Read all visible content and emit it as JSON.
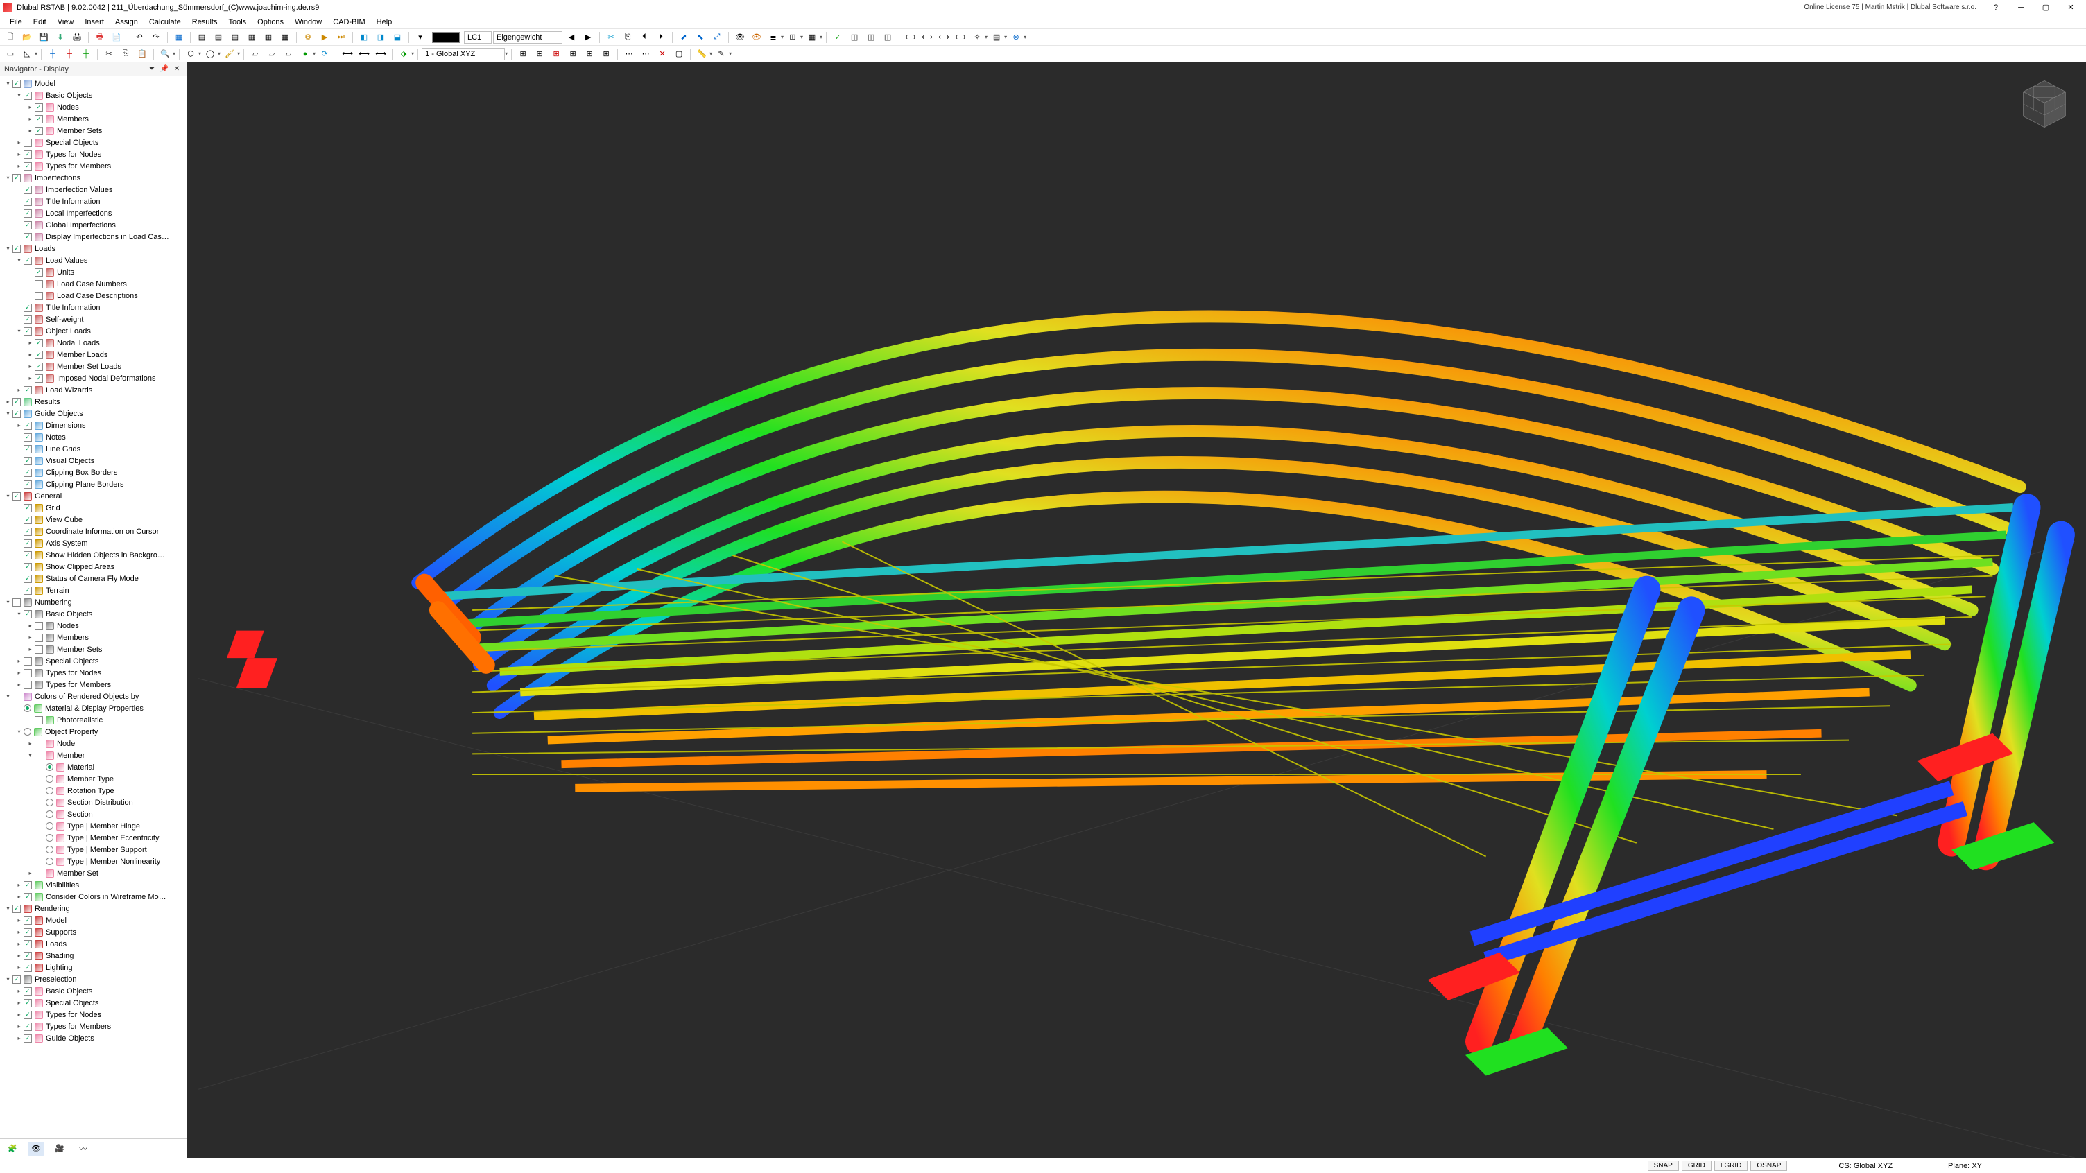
{
  "title": "Dlubal RSTAB | 9.02.0042 | 211_Überdachung_Sömmersdorf_(C)www.joachim-ing.de.rs9",
  "title_right": "Online License 75 | Martin Mstrik | Dlubal Software s.r.o.",
  "menu": [
    "File",
    "Edit",
    "View",
    "Insert",
    "Assign",
    "Calculate",
    "Results",
    "Tools",
    "Options",
    "Window",
    "CAD-BIM",
    "Help"
  ],
  "toolbar1": {
    "lc_code": "LC1",
    "lc_name": "Eigengewicht"
  },
  "toolbar2": {
    "cs": "1 - Global XYZ"
  },
  "navigator": {
    "title": "Navigator - Display",
    "bottom_tabs": [
      "data-icon",
      "eye-icon",
      "views-icon",
      "results-icon"
    ]
  },
  "tree": {
    "model": "Model",
    "basic_objects": "Basic Objects",
    "nodes": "Nodes",
    "members": "Members",
    "member_sets": "Member Sets",
    "special_objects": "Special Objects",
    "types_for_nodes": "Types for Nodes",
    "types_for_members": "Types for Members",
    "imperfections": "Imperfections",
    "imperfection_values": "Imperfection Values",
    "title_info": "Title Information",
    "local_imperfections": "Local Imperfections",
    "global_imperfections": "Global Imperfections",
    "display_imperfections_in_load": "Display Imperfections in Load Cas…",
    "loads": "Loads",
    "load_values": "Load Values",
    "units": "Units",
    "load_case_numbers": "Load Case Numbers",
    "load_case_descriptions": "Load Case Descriptions",
    "title_information2": "Title Information",
    "self_weight": "Self-weight",
    "object_loads": "Object Loads",
    "nodal_loads": "Nodal Loads",
    "member_loads": "Member Loads",
    "member_set_loads": "Member Set Loads",
    "imposed_nodal_def": "Imposed Nodal Deformations",
    "load_wizards": "Load Wizards",
    "results": "Results",
    "guide_objects": "Guide Objects",
    "dimensions": "Dimensions",
    "notes": "Notes",
    "line_grids": "Line Grids",
    "visual_objects": "Visual Objects",
    "clipping_box_borders": "Clipping Box Borders",
    "clipping_plane_borders": "Clipping Plane Borders",
    "general": "General",
    "grid": "Grid",
    "view_cube": "View Cube",
    "coord_info_on_cursor": "Coordinate Information on Cursor",
    "axis_system": "Axis System",
    "show_hidden_bg": "Show Hidden Objects in Backgro…",
    "show_clipped_areas": "Show Clipped Areas",
    "status_camera_fly": "Status of Camera Fly Mode",
    "terrain": "Terrain",
    "numbering": "Numbering",
    "basic_objects2": "Basic Objects",
    "nodes2": "Nodes",
    "members2": "Members",
    "member_sets2": "Member Sets",
    "special_objects2": "Special Objects",
    "types_for_nodes2": "Types for Nodes",
    "types_for_members2": "Types for Members",
    "colors_rendered": "Colors of Rendered Objects by",
    "material_display_prop": "Material & Display Properties",
    "photorealistic": "Photorealistic",
    "object_property": "Object Property",
    "node": "Node",
    "member": "Member",
    "material": "Material",
    "member_type": "Member Type",
    "rotation_type": "Rotation Type",
    "section_distribution": "Section Distribution",
    "section": "Section",
    "type_member_hinge": "Type | Member Hinge",
    "type_member_ecc": "Type | Member Eccentricity",
    "type_member_support": "Type | Member Support",
    "type_member_nonlin": "Type | Member Nonlinearity",
    "member_set": "Member Set",
    "visibilities": "Visibilities",
    "consider_colors_wire": "Consider Colors in Wireframe Mo…",
    "rendering": "Rendering",
    "model2": "Model",
    "supports": "Supports",
    "loads2": "Loads",
    "shading": "Shading",
    "lighting": "Lighting",
    "preselection": "Preselection",
    "basic_objects3": "Basic Objects",
    "special_objects3": "Special Objects",
    "types_for_nodes3": "Types for Nodes",
    "types_for_members3": "Types for Members",
    "guide_objects2": "Guide Objects"
  },
  "status": {
    "snap": "SNAP",
    "grid": "GRID",
    "lgrid": "LGRID",
    "osnap": "OSNAP",
    "cs_lbl": "CS:",
    "cs_val": "Global XYZ",
    "plane_lbl": "Plane:",
    "plane_val": "XY"
  }
}
